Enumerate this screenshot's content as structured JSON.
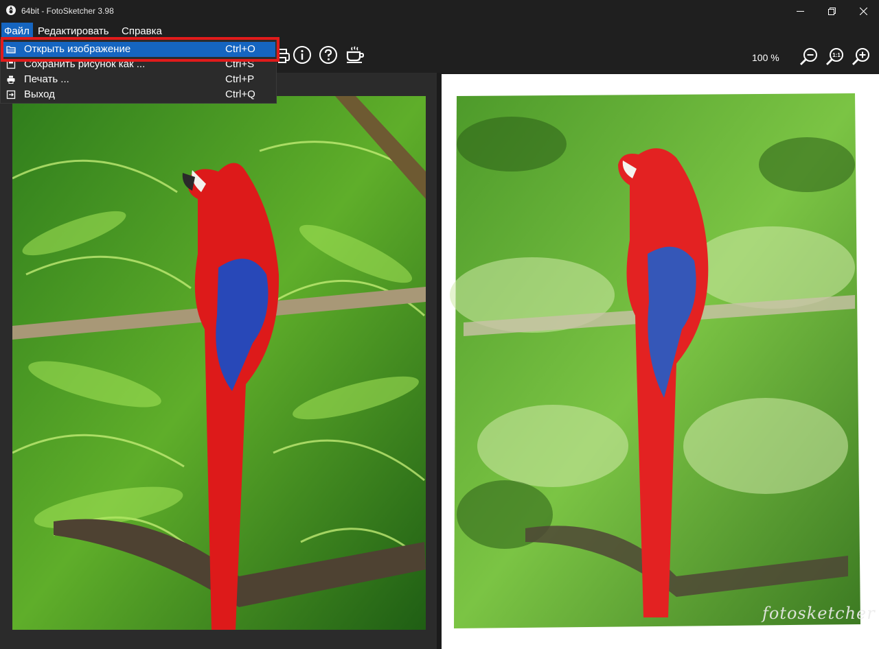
{
  "window": {
    "title": "64bit - FotoSketcher 3.98"
  },
  "menubar": {
    "items": [
      "Файл",
      "Редактировать",
      "Справка"
    ]
  },
  "file_menu": {
    "items": [
      {
        "label": "Открыть изображение",
        "shortcut": "Ctrl+O",
        "icon": "folder-icon"
      },
      {
        "label": "Сохранить рисунок как ...",
        "shortcut": "Ctrl+S",
        "icon": "save-icon"
      },
      {
        "label": "Печать ...",
        "shortcut": "Ctrl+P",
        "icon": "print-icon"
      },
      {
        "label": "Выход",
        "shortcut": "Ctrl+Q",
        "icon": "exit-icon"
      }
    ]
  },
  "toolbar": {
    "icons": [
      "print-icon",
      "info-icon",
      "help-icon",
      "coffee-icon"
    ],
    "zoom_level": "100 %",
    "zoom_icons": [
      "zoom-out-icon",
      "zoom-actual-size-icon",
      "zoom-in-icon"
    ],
    "zoom_actual_label": "1:1"
  },
  "canvas": {
    "signature": "fotosketcher"
  },
  "colors": {
    "accent": "#1565c0",
    "highlight_border": "#e11b1b",
    "background": "#1b1b1b",
    "panel": "#2b2b2b"
  }
}
